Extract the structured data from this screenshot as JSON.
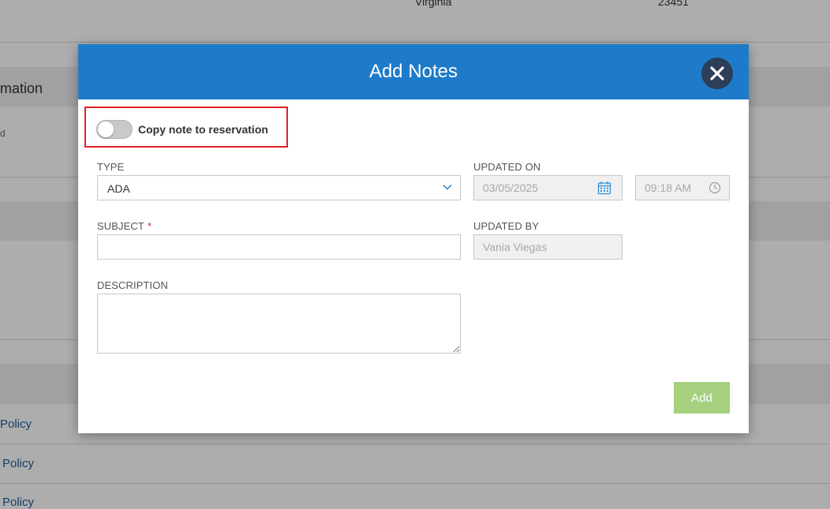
{
  "background": {
    "state_value": "Virginia",
    "zip_value": "23451",
    "section_title": "mation",
    "small_text": "d",
    "policy_links": [
      "Policy",
      "Policy",
      "Policy"
    ]
  },
  "modal": {
    "title": "Add Notes",
    "close_icon": "close-icon",
    "copy_toggle": {
      "label": "Copy note to reservation",
      "on": false
    },
    "type": {
      "label": "TYPE",
      "value": "ADA"
    },
    "updated_on": {
      "label": "UPDATED ON",
      "date": "03/05/2025",
      "time": "09:18 AM"
    },
    "subject": {
      "label": "SUBJECT",
      "required_mark": "*",
      "value": ""
    },
    "updated_by": {
      "label": "UPDATED BY",
      "value": "Vania Viegas"
    },
    "description": {
      "label": "DESCRIPTION",
      "value": ""
    },
    "add_button": "Add"
  },
  "colors": {
    "header_blue": "#1e7bc9",
    "close_button": "#2c3e58",
    "highlight_red": "#e02027",
    "add_button_green": "#a6cf7e",
    "link_blue": "#1f5c99"
  }
}
